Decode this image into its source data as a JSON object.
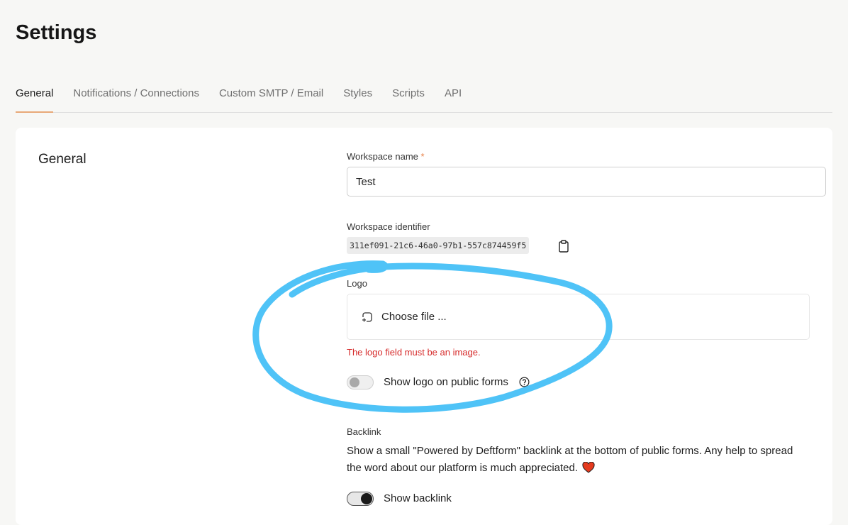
{
  "page": {
    "title": "Settings"
  },
  "tabs": [
    {
      "label": "General"
    },
    {
      "label": "Notifications / Connections"
    },
    {
      "label": "Custom SMTP / Email"
    },
    {
      "label": "Styles"
    },
    {
      "label": "Scripts"
    },
    {
      "label": "API"
    }
  ],
  "active_tab": "General",
  "section": {
    "title": "General"
  },
  "workspace_name": {
    "label": "Workspace name",
    "required_mark": "*",
    "value": "Test"
  },
  "workspace_identifier": {
    "label": "Workspace identifier",
    "value": "311ef091-21c6-46a0-97b1-557c874459f5"
  },
  "logo": {
    "label": "Logo",
    "choose_label": "Choose file ...",
    "error": "The logo field must be an image.",
    "show_toggle": {
      "label": "Show logo on public forms",
      "on": false
    }
  },
  "backlink": {
    "label": "Backlink",
    "description": "Show a small \"Powered by Deftform\" backlink at the bottom of public forms. Any help to spread the word about our platform is much appreciated.",
    "toggle": {
      "label": "Show backlink",
      "on": true
    }
  },
  "annotation": {
    "color": "#4fc3f7"
  },
  "colors": {
    "accent_underline": "#e8a878",
    "error": "#d62c2c",
    "heart": "#e53a1e"
  },
  "icons": [
    "clipboard-icon",
    "file-upload-icon",
    "help-circle-icon",
    "heart-icon"
  ]
}
